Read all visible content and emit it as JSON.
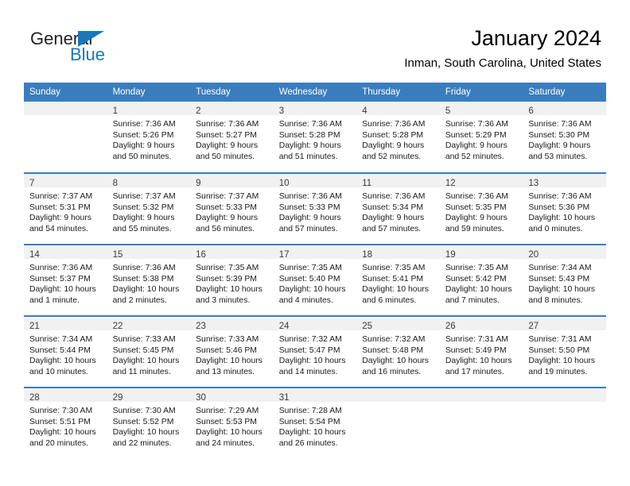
{
  "brand": {
    "name_part1": "General",
    "name_part2": "Blue",
    "accent_color": "#1878be",
    "text_color": "#231f20"
  },
  "header": {
    "title": "January 2024",
    "location": "Inman, South Carolina, United States"
  },
  "calendar": {
    "header_bg": "#3a7dbf",
    "daynum_band_bg": "#f1f1f1",
    "weekday_headers": [
      "Sunday",
      "Monday",
      "Tuesday",
      "Wednesday",
      "Thursday",
      "Friday",
      "Saturday"
    ],
    "weeks": [
      [
        {
          "day": "",
          "lines": []
        },
        {
          "day": "1",
          "lines": [
            "Sunrise: 7:36 AM",
            "Sunset: 5:26 PM",
            "Daylight: 9 hours",
            "and 50 minutes."
          ]
        },
        {
          "day": "2",
          "lines": [
            "Sunrise: 7:36 AM",
            "Sunset: 5:27 PM",
            "Daylight: 9 hours",
            "and 50 minutes."
          ]
        },
        {
          "day": "3",
          "lines": [
            "Sunrise: 7:36 AM",
            "Sunset: 5:28 PM",
            "Daylight: 9 hours",
            "and 51 minutes."
          ]
        },
        {
          "day": "4",
          "lines": [
            "Sunrise: 7:36 AM",
            "Sunset: 5:28 PM",
            "Daylight: 9 hours",
            "and 52 minutes."
          ]
        },
        {
          "day": "5",
          "lines": [
            "Sunrise: 7:36 AM",
            "Sunset: 5:29 PM",
            "Daylight: 9 hours",
            "and 52 minutes."
          ]
        },
        {
          "day": "6",
          "lines": [
            "Sunrise: 7:36 AM",
            "Sunset: 5:30 PM",
            "Daylight: 9 hours",
            "and 53 minutes."
          ]
        }
      ],
      [
        {
          "day": "7",
          "lines": [
            "Sunrise: 7:37 AM",
            "Sunset: 5:31 PM",
            "Daylight: 9 hours",
            "and 54 minutes."
          ]
        },
        {
          "day": "8",
          "lines": [
            "Sunrise: 7:37 AM",
            "Sunset: 5:32 PM",
            "Daylight: 9 hours",
            "and 55 minutes."
          ]
        },
        {
          "day": "9",
          "lines": [
            "Sunrise: 7:37 AM",
            "Sunset: 5:33 PM",
            "Daylight: 9 hours",
            "and 56 minutes."
          ]
        },
        {
          "day": "10",
          "lines": [
            "Sunrise: 7:36 AM",
            "Sunset: 5:33 PM",
            "Daylight: 9 hours",
            "and 57 minutes."
          ]
        },
        {
          "day": "11",
          "lines": [
            "Sunrise: 7:36 AM",
            "Sunset: 5:34 PM",
            "Daylight: 9 hours",
            "and 57 minutes."
          ]
        },
        {
          "day": "12",
          "lines": [
            "Sunrise: 7:36 AM",
            "Sunset: 5:35 PM",
            "Daylight: 9 hours",
            "and 59 minutes."
          ]
        },
        {
          "day": "13",
          "lines": [
            "Sunrise: 7:36 AM",
            "Sunset: 5:36 PM",
            "Daylight: 10 hours",
            "and 0 minutes."
          ]
        }
      ],
      [
        {
          "day": "14",
          "lines": [
            "Sunrise: 7:36 AM",
            "Sunset: 5:37 PM",
            "Daylight: 10 hours",
            "and 1 minute."
          ]
        },
        {
          "day": "15",
          "lines": [
            "Sunrise: 7:36 AM",
            "Sunset: 5:38 PM",
            "Daylight: 10 hours",
            "and 2 minutes."
          ]
        },
        {
          "day": "16",
          "lines": [
            "Sunrise: 7:35 AM",
            "Sunset: 5:39 PM",
            "Daylight: 10 hours",
            "and 3 minutes."
          ]
        },
        {
          "day": "17",
          "lines": [
            "Sunrise: 7:35 AM",
            "Sunset: 5:40 PM",
            "Daylight: 10 hours",
            "and 4 minutes."
          ]
        },
        {
          "day": "18",
          "lines": [
            "Sunrise: 7:35 AM",
            "Sunset: 5:41 PM",
            "Daylight: 10 hours",
            "and 6 minutes."
          ]
        },
        {
          "day": "19",
          "lines": [
            "Sunrise: 7:35 AM",
            "Sunset: 5:42 PM",
            "Daylight: 10 hours",
            "and 7 minutes."
          ]
        },
        {
          "day": "20",
          "lines": [
            "Sunrise: 7:34 AM",
            "Sunset: 5:43 PM",
            "Daylight: 10 hours",
            "and 8 minutes."
          ]
        }
      ],
      [
        {
          "day": "21",
          "lines": [
            "Sunrise: 7:34 AM",
            "Sunset: 5:44 PM",
            "Daylight: 10 hours",
            "and 10 minutes."
          ]
        },
        {
          "day": "22",
          "lines": [
            "Sunrise: 7:33 AM",
            "Sunset: 5:45 PM",
            "Daylight: 10 hours",
            "and 11 minutes."
          ]
        },
        {
          "day": "23",
          "lines": [
            "Sunrise: 7:33 AM",
            "Sunset: 5:46 PM",
            "Daylight: 10 hours",
            "and 13 minutes."
          ]
        },
        {
          "day": "24",
          "lines": [
            "Sunrise: 7:32 AM",
            "Sunset: 5:47 PM",
            "Daylight: 10 hours",
            "and 14 minutes."
          ]
        },
        {
          "day": "25",
          "lines": [
            "Sunrise: 7:32 AM",
            "Sunset: 5:48 PM",
            "Daylight: 10 hours",
            "and 16 minutes."
          ]
        },
        {
          "day": "26",
          "lines": [
            "Sunrise: 7:31 AM",
            "Sunset: 5:49 PM",
            "Daylight: 10 hours",
            "and 17 minutes."
          ]
        },
        {
          "day": "27",
          "lines": [
            "Sunrise: 7:31 AM",
            "Sunset: 5:50 PM",
            "Daylight: 10 hours",
            "and 19 minutes."
          ]
        }
      ],
      [
        {
          "day": "28",
          "lines": [
            "Sunrise: 7:30 AM",
            "Sunset: 5:51 PM",
            "Daylight: 10 hours",
            "and 20 minutes."
          ]
        },
        {
          "day": "29",
          "lines": [
            "Sunrise: 7:30 AM",
            "Sunset: 5:52 PM",
            "Daylight: 10 hours",
            "and 22 minutes."
          ]
        },
        {
          "day": "30",
          "lines": [
            "Sunrise: 7:29 AM",
            "Sunset: 5:53 PM",
            "Daylight: 10 hours",
            "and 24 minutes."
          ]
        },
        {
          "day": "31",
          "lines": [
            "Sunrise: 7:28 AM",
            "Sunset: 5:54 PM",
            "Daylight: 10 hours",
            "and 26 minutes."
          ]
        },
        {
          "day": "",
          "lines": []
        },
        {
          "day": "",
          "lines": []
        },
        {
          "day": "",
          "lines": []
        }
      ]
    ]
  }
}
